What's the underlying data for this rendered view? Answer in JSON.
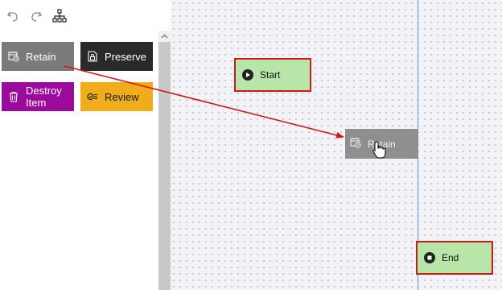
{
  "toolbar": {
    "undo_icon": "undo-icon",
    "redo_icon": "redo-icon",
    "layout_icon": "hierarchy-icon"
  },
  "actions": [
    {
      "label": "Retain",
      "icon": "calendar-clock-icon",
      "color": "#7a7a7a"
    },
    {
      "label": "Preserve",
      "icon": "lock-document-icon",
      "color": "#2a2a2a"
    },
    {
      "label": "Destroy Item",
      "icon": "trash-icon",
      "color": "#9b0b9b"
    },
    {
      "label": "Review",
      "icon": "checklist-icon",
      "color": "#f0ad1b"
    }
  ],
  "canvas": {
    "nodes": {
      "start": {
        "label": "Start",
        "icon": "play-icon",
        "color": "#b7e6a8"
      },
      "dragged": {
        "label": "Retain",
        "icon": "calendar-clock-icon",
        "color": "#8f8f8f"
      },
      "end": {
        "label": "End",
        "icon": "stop-icon",
        "color": "#b7e6a8"
      }
    },
    "accent_colors": {
      "highlight_border": "#cc1a1a",
      "guide_line": "#5b9bd5"
    }
  }
}
